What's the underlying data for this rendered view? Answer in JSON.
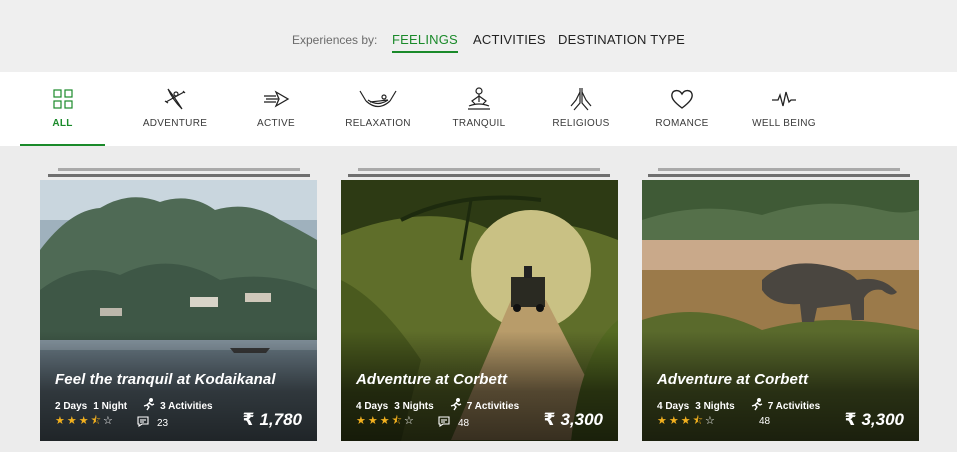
{
  "experiences_by": {
    "label": "Experiences by:",
    "tabs": [
      {
        "label": "FEELINGS",
        "active": true
      },
      {
        "label": "ACTIVITIES",
        "active": false
      },
      {
        "label": "DESTINATION TYPE",
        "active": false
      }
    ]
  },
  "categories": [
    {
      "label": "ALL",
      "icon": "grid-icon",
      "active": true
    },
    {
      "label": "ADVENTURE",
      "icon": "kayak-icon",
      "active": false
    },
    {
      "label": "ACTIVE",
      "icon": "speed-arrow-icon",
      "active": false
    },
    {
      "label": "RELAXATION",
      "icon": "hammock-icon",
      "active": false
    },
    {
      "label": "TRANQUIL",
      "icon": "meditation-icon",
      "active": false
    },
    {
      "label": "RELIGIOUS",
      "icon": "praying-hands-icon",
      "active": false
    },
    {
      "label": "ROMANCE",
      "icon": "heart-icon",
      "active": false
    },
    {
      "label": "WELL BEING",
      "icon": "heartbeat-icon",
      "active": false
    }
  ],
  "colors": {
    "accent": "#1a8a2a",
    "star": "#f2b01e"
  },
  "cards": [
    {
      "title": "Feel the tranquil at Kodaikanal",
      "days": "2 Days",
      "nights": "1 Night",
      "activities": "3 Activities",
      "rating": 3.5,
      "reviews": "23",
      "currency": "₹",
      "price": "1,780",
      "image": "lake-hills-photo"
    },
    {
      "title": "Adventure at Corbett",
      "days": "4 Days",
      "nights": "3 Nights",
      "activities": "7 Activities",
      "rating": 3.5,
      "reviews": "48",
      "currency": "₹",
      "price": "3,300",
      "image": "forest-jeep-photo"
    },
    {
      "title": "Adventure at Corbett",
      "days": "4 Days",
      "nights": "3 Nights",
      "activities": "7 Activities",
      "rating": 3.5,
      "reviews": "48",
      "currency": "₹",
      "price": "3,300",
      "image": "elephant-grassland-photo"
    }
  ]
}
